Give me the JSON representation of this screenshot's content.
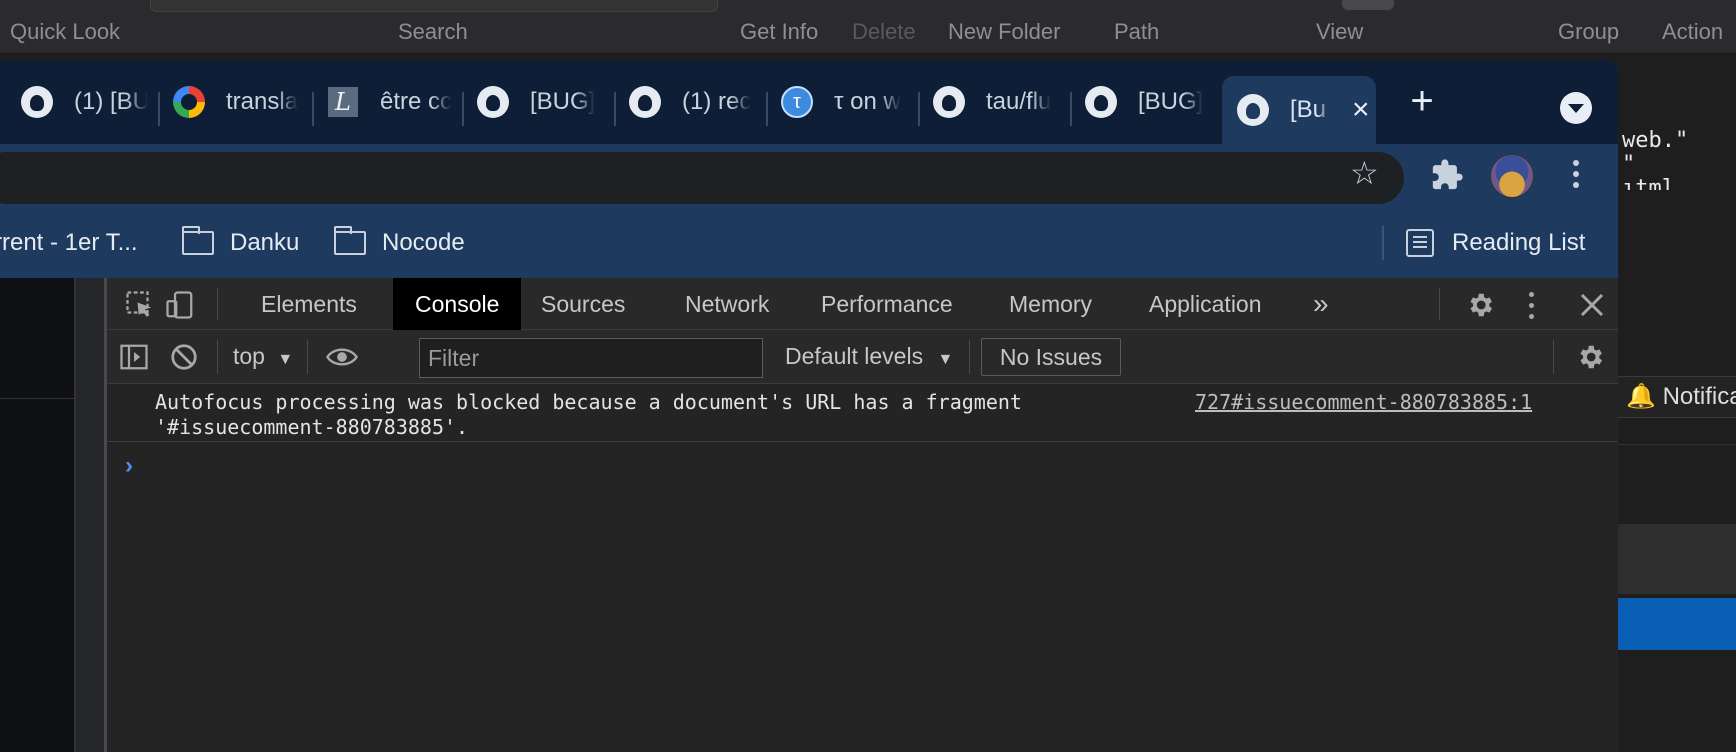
{
  "finder": {
    "quick_look": "Quick Look",
    "search": "Search",
    "get_info": "Get Info",
    "delete": "Delete",
    "new_folder": "New Folder",
    "path": "Path",
    "view": "View",
    "group": "Group",
    "action": "Action"
  },
  "editor": {
    "lines": [
      "web.\"",
      "\"",
      "ıtml"
    ],
    "notification": "Notifica"
  },
  "tabs": [
    {
      "icon": "github-icon",
      "title": "(1) [BU"
    },
    {
      "icon": "google-icon",
      "title": "transla"
    },
    {
      "icon": "l-letter-icon",
      "title": "être cc"
    },
    {
      "icon": "github-icon",
      "title": "[BUG]"
    },
    {
      "icon": "github-icon",
      "title": "(1) rec"
    },
    {
      "icon": "tau-icon",
      "title": "τ on w"
    },
    {
      "icon": "github-icon",
      "title": "tau/flu"
    },
    {
      "icon": "github-icon",
      "title": "[BUG]"
    },
    {
      "icon": "github-icon",
      "title": "[Bu",
      "active": true
    }
  ],
  "toolbar": {
    "new_tab": "+",
    "close_tab": "×"
  },
  "bookmarks": [
    {
      "icon": "folder-icon",
      "label": "rrent - 1er T..."
    },
    {
      "icon": "folder-icon",
      "label": "Danku"
    },
    {
      "icon": "folder-icon",
      "label": "Nocode"
    }
  ],
  "reading_list": "Reading List",
  "devtools": {
    "tabs": [
      "Elements",
      "Console",
      "Sources",
      "Network",
      "Performance",
      "Memory",
      "Application"
    ],
    "active_tab": "Console",
    "more_tabs": "»",
    "context": "top",
    "filter_placeholder": "Filter",
    "levels": "Default levels",
    "issues": "No Issues",
    "message": "Autofocus processing was blocked because a document's URL has a fragment\n'#issuecomment-880783885'.",
    "source_link": "727#issuecomment-880783885:1",
    "prompt": "›"
  },
  "colors": {
    "tabstrip": "#0d1e36",
    "toolbar": "#1f3a5f",
    "devtools_bg": "#242424",
    "prompt": "#4f8ff0"
  }
}
